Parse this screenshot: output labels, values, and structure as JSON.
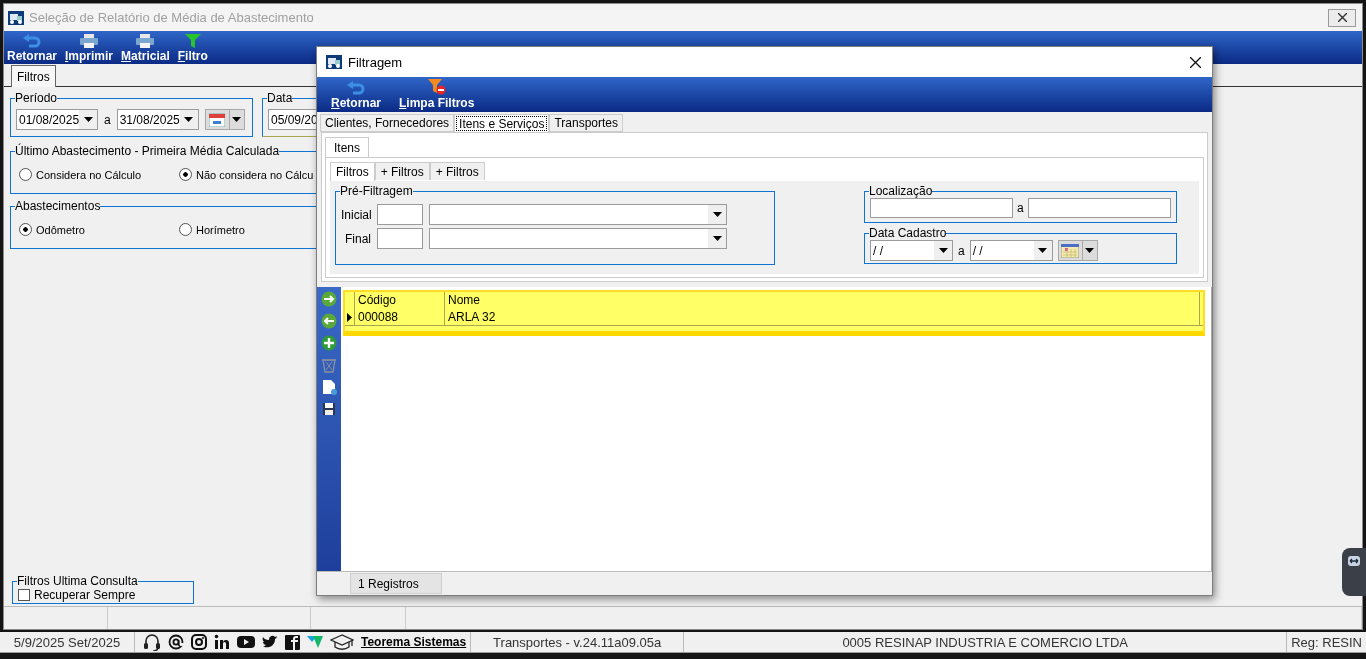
{
  "main_window": {
    "title": "Seleção de Relatório de Média de Abastecimento",
    "toolbar": [
      {
        "label": "Retornar",
        "accelerator": false
      },
      {
        "label": "Imprimir",
        "accelerator": true
      },
      {
        "label": "Matricial",
        "accelerator": true
      },
      {
        "label": "Filtro",
        "accelerator": true
      }
    ],
    "tabs": [
      {
        "label": "Filtros",
        "selected": true
      }
    ],
    "periodo": {
      "title": "Período",
      "from": "01/08/2025",
      "separator": "a",
      "to": "31/08/2025"
    },
    "data": {
      "title": "Data",
      "value": "05/09/20"
    },
    "ultimo_abastecimento": {
      "title": "Último Abastecimento - Primeira Média Calculada",
      "options": [
        {
          "label": "Considera no Cálculo",
          "selected": false
        },
        {
          "label": "Não considera no Cálcu",
          "selected": true
        }
      ]
    },
    "abastecimentos": {
      "title": "Abastecimentos",
      "options": [
        {
          "label": "Odômetro",
          "selected": true
        },
        {
          "label": "Horímetro",
          "selected": false
        }
      ]
    },
    "filtros_ultima_consulta": {
      "title": "Filtros Ultima Consulta",
      "checkbox": {
        "label": "Recuperar Sempre",
        "checked": false
      }
    }
  },
  "dialog": {
    "title": "Filtragem",
    "toolbar": [
      {
        "label": "Retornar",
        "accelerator": true
      },
      {
        "label": "Limpa Filtros",
        "accelerator": true
      }
    ],
    "tabs": [
      {
        "label": "Clientes, Fornecedores",
        "selected": false
      },
      {
        "label": "Itens e Serviços",
        "selected": true
      },
      {
        "label": "Transportes",
        "selected": false
      }
    ],
    "subtabs": [
      {
        "label": "Itens",
        "selected": true
      }
    ],
    "filter_tabs": [
      {
        "label": "Filtros",
        "selected": true
      },
      {
        "label": "+ Filtros",
        "selected": false
      },
      {
        "label": "+ Filtros",
        "selected": false
      }
    ],
    "pre_filtragem": {
      "title": "Pré-Filtragem",
      "rows": [
        {
          "label": "Inicial"
        },
        {
          "label": "Final"
        }
      ]
    },
    "localizacao": {
      "title": "Localização",
      "separator": "a"
    },
    "data_cadastro": {
      "title": "Data Cadastro",
      "from": "/ /",
      "separator": "a",
      "to": "/ /"
    },
    "table": {
      "columns": [
        "Código",
        "Nome"
      ],
      "rows": [
        {
          "cells": [
            "000088",
            "ARLA 32"
          ],
          "selected": true
        }
      ]
    },
    "status": "1 Registros"
  },
  "status_bar": {
    "date": "5/9/2025 Set/2025",
    "link": "Teorema Sistemas",
    "version": "Transportes - v.24.11a09.05a",
    "company": "0005 RESINAP INDUSTRIA E COMERCIO LTDA",
    "reg": "Reg: RESIN"
  }
}
